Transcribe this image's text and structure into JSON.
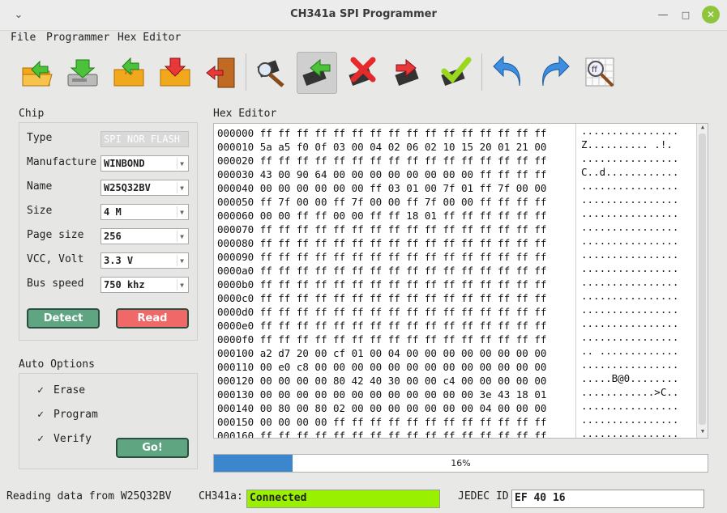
{
  "window": {
    "title": "CH341a SPI Programmer"
  },
  "menu": [
    "File",
    "Programmer",
    "Hex Editor"
  ],
  "toolbar": [
    {
      "name": "open-file-icon"
    },
    {
      "name": "save-file-icon"
    },
    {
      "name": "load-chip-icon"
    },
    {
      "name": "save-chip-icon"
    },
    {
      "name": "exit-door-icon"
    },
    {
      "name": "chip-search-icon"
    },
    {
      "name": "chip-read-icon",
      "pressed": true
    },
    {
      "name": "chip-erase-icon"
    },
    {
      "name": "chip-write-icon"
    },
    {
      "name": "chip-verify-icon"
    },
    {
      "name": "undo-icon"
    },
    {
      "name": "redo-icon"
    },
    {
      "name": "find-hex-icon"
    }
  ],
  "chip": {
    "label": "Chip",
    "type_label": "Type",
    "type_value": "SPI NOR FLASH",
    "manufacture_label": "Manufacture",
    "manufacture_value": "WINBOND",
    "name_label": "Name",
    "name_value": "W25Q32BV",
    "size_label": "Size",
    "size_value": "4 M",
    "pagesize_label": "Page size",
    "pagesize_value": "256",
    "vcc_label": "VCC, Volt",
    "vcc_value": "3.3 V",
    "busspeed_label": "Bus speed",
    "busspeed_value": "750 khz",
    "detect_label": "Detect",
    "read_label": "Read"
  },
  "auto": {
    "label": "Auto Options",
    "erase": "Erase",
    "program": "Program",
    "verify": "Verify",
    "go": "Go!"
  },
  "hex": {
    "label": "Hex Editor",
    "rows": [
      {
        "addr": "000000",
        "bytes": "ff ff ff ff ff ff ff ff ff ff ff ff ff ff ff ff",
        "ascii": "................"
      },
      {
        "addr": "000010",
        "bytes": "5a a5 f0 0f 03 00 04 02 06 02 10 15 20 01 21 00",
        "ascii": "Z.......... .!."
      },
      {
        "addr": "000020",
        "bytes": "ff ff ff ff ff ff ff ff ff ff ff ff ff ff ff ff",
        "ascii": "................"
      },
      {
        "addr": "000030",
        "bytes": "43 00 90 64 00 00 00 00 00 00 00 00 ff ff ff ff",
        "ascii": "C..d............"
      },
      {
        "addr": "000040",
        "bytes": "00 00 00 00 00 00 ff 03 01 00 7f 01 ff 7f 00 00",
        "ascii": "................"
      },
      {
        "addr": "000050",
        "bytes": "ff 7f 00 00 ff 7f 00 00 ff 7f 00 00 ff ff ff ff",
        "ascii": "................"
      },
      {
        "addr": "000060",
        "bytes": "00 00 ff ff 00 00 ff ff 18 01 ff ff ff ff ff ff",
        "ascii": "................"
      },
      {
        "addr": "000070",
        "bytes": "ff ff ff ff ff ff ff ff ff ff ff ff ff ff ff ff",
        "ascii": "................"
      },
      {
        "addr": "000080",
        "bytes": "ff ff ff ff ff ff ff ff ff ff ff ff ff ff ff ff",
        "ascii": "................"
      },
      {
        "addr": "000090",
        "bytes": "ff ff ff ff ff ff ff ff ff ff ff ff ff ff ff ff",
        "ascii": "................"
      },
      {
        "addr": "0000a0",
        "bytes": "ff ff ff ff ff ff ff ff ff ff ff ff ff ff ff ff",
        "ascii": "................"
      },
      {
        "addr": "0000b0",
        "bytes": "ff ff ff ff ff ff ff ff ff ff ff ff ff ff ff ff",
        "ascii": "................"
      },
      {
        "addr": "0000c0",
        "bytes": "ff ff ff ff ff ff ff ff ff ff ff ff ff ff ff ff",
        "ascii": "................"
      },
      {
        "addr": "0000d0",
        "bytes": "ff ff ff ff ff ff ff ff ff ff ff ff ff ff ff ff",
        "ascii": "................"
      },
      {
        "addr": "0000e0",
        "bytes": "ff ff ff ff ff ff ff ff ff ff ff ff ff ff ff ff",
        "ascii": "................"
      },
      {
        "addr": "0000f0",
        "bytes": "ff ff ff ff ff ff ff ff ff ff ff ff ff ff ff ff",
        "ascii": "................"
      },
      {
        "addr": "000100",
        "bytes": "a2 d7 20 00 cf 01 00 04 00 00 00 00 00 00 00 00",
        "ascii": ".. ............."
      },
      {
        "addr": "000110",
        "bytes": "00 e0 c8 00 00 00 00 00 00 00 00 00 00 00 00 00",
        "ascii": "................"
      },
      {
        "addr": "000120",
        "bytes": "00 00 00 00 80 42 40 30 00 00 c4 00 00 00 00 00",
        "ascii": ".....B@0........"
      },
      {
        "addr": "000130",
        "bytes": "00 00 00 00 00 00 00 00 00 00 00 00 3e 43 18 01",
        "ascii": "............>C.."
      },
      {
        "addr": "000140",
        "bytes": "00 80 00 80 02 00 00 00 00 00 00 00 04 00 00 00",
        "ascii": "................"
      },
      {
        "addr": "000150",
        "bytes": "00 00 00 00 ff ff ff ff ff ff ff ff ff ff ff ff",
        "ascii": "................"
      },
      {
        "addr": "000160",
        "bytes": "ff ff ff ff ff ff ff ff ff ff ff ff ff ff ff ff",
        "ascii": "................"
      }
    ]
  },
  "progress": {
    "value": 0.16,
    "text": "16%"
  },
  "statusbar": {
    "message": "Reading data from W25Q32BV",
    "ch341a_label": "CH341a:",
    "ch341a_value": "Connected",
    "jedec_label": "JEDEC ID",
    "jedec_value": "EF 40 16"
  },
  "colors": {
    "detect_btn": "#5fa582",
    "read_btn": "#f06868",
    "go_btn": "#5fa582",
    "connected": "#99f000",
    "progress": "#3b86cc",
    "close_btn": "#8fc53c"
  }
}
